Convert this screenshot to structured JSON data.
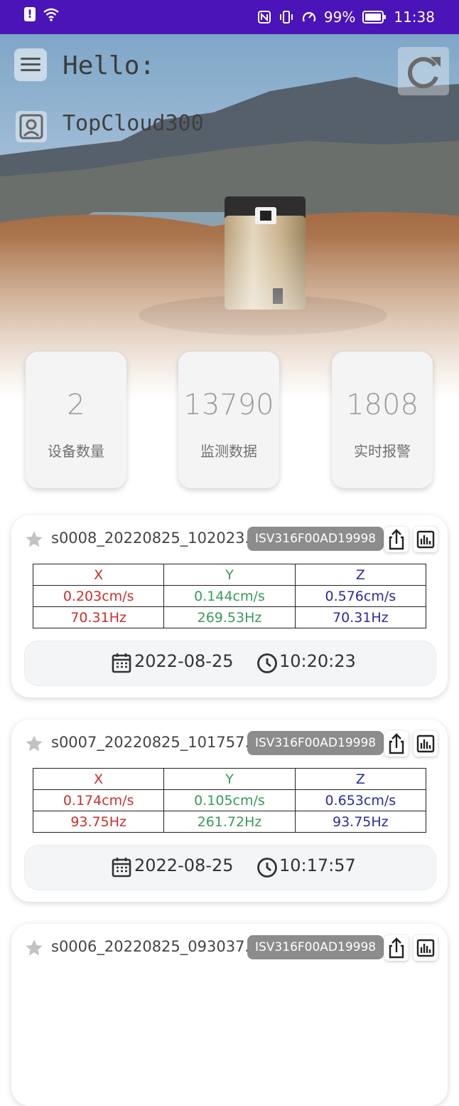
{
  "status_bar": {
    "battery": "99%",
    "time": "11:38"
  },
  "header": {
    "greeting": "Hello:",
    "username": "TopCloud300"
  },
  "stats": [
    {
      "value": "2",
      "label": "设备数量"
    },
    {
      "value": "13790",
      "label": "监测数据"
    },
    {
      "value": "1808",
      "label": "实时报警"
    }
  ],
  "records": [
    {
      "filename": "s0008_20220825_102023.da",
      "device_id": "ISV316F00AD19998",
      "table": {
        "headers": [
          "X",
          "Y",
          "Z"
        ],
        "velocity": [
          "0.203cm/s",
          "0.144cm/s",
          "0.576cm/s"
        ],
        "frequency": [
          "70.31Hz",
          "269.53Hz",
          "70.31Hz"
        ]
      },
      "date": "2022-08-25",
      "time": "10:20:23"
    },
    {
      "filename": "s0007_20220825_101757.da",
      "device_id": "ISV316F00AD19998",
      "table": {
        "headers": [
          "X",
          "Y",
          "Z"
        ],
        "velocity": [
          "0.174cm/s",
          "0.105cm/s",
          "0.653cm/s"
        ],
        "frequency": [
          "93.75Hz",
          "261.72Hz",
          "93.75Hz"
        ]
      },
      "date": "2022-08-25",
      "time": "10:17:57"
    },
    {
      "filename": "s0006_20220825_093037.da",
      "device_id": "ISV316F00AD19998"
    }
  ],
  "colors": {
    "status_bar": "#4a14b8",
    "x_axis": "#c9302c",
    "y_axis": "#3a9a5a",
    "z_axis": "#2b2b9a",
    "badge": "#8c8c8c"
  }
}
